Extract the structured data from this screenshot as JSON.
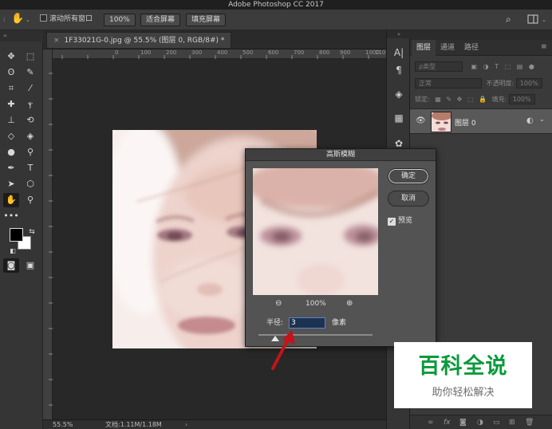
{
  "app": {
    "title": "Adobe Photoshop CC 2017"
  },
  "options_bar": {
    "scroll_all_windows": "滚动所有窗口",
    "zoom_button": "100%",
    "fit_screen": "适合屏幕",
    "fill_screen": "填充屏幕"
  },
  "document": {
    "tab_label": "1F33021G-0.jpg @ 55.5% (图层 0, RGB/8#) *",
    "ruler_ticks": [
      "0",
      "100",
      "200",
      "300",
      "400",
      "500",
      "600",
      "700",
      "800",
      "900",
      "1000",
      "110"
    ]
  },
  "status_bar": {
    "zoom": "55.5%",
    "doc_info": "文档:1.11M/1.18M"
  },
  "toolbar": {
    "grip": "»"
  },
  "dialog": {
    "title": "高斯模糊",
    "ok": "确定",
    "cancel": "取消",
    "preview_label": "预览",
    "preview_checked": true,
    "zoom_value": "100%",
    "radius_label": "半径:",
    "radius_value": "3",
    "radius_unit": "像素"
  },
  "layers_panel": {
    "tabs": [
      "图层",
      "通道",
      "路径"
    ],
    "filter_label": "ρ类型",
    "blend_mode": "正常",
    "opacity_label": "不透明度:",
    "opacity_value": "100%",
    "lock_label": "锁定:",
    "fill_label": "填充:",
    "fill_value": "100%",
    "layer_name": "图层 0"
  },
  "watermark": {
    "main": "百科全说",
    "sub": "助你轻松解决"
  },
  "colors": {
    "accent": "#0a9a3c",
    "arrow": "#c4131a",
    "input_focus": "#5b82c4"
  }
}
